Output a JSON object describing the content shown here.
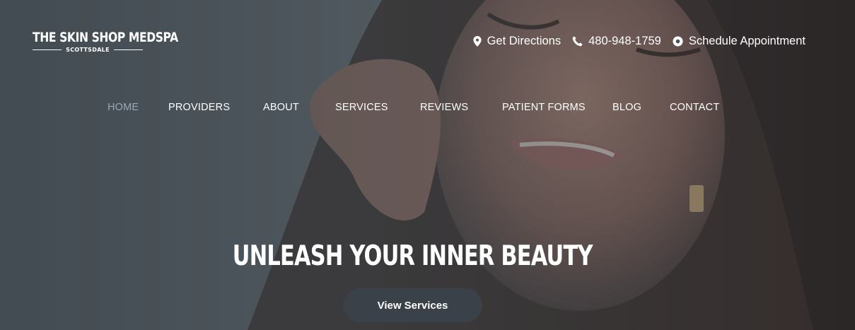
{
  "brand": {
    "name": "THE SKIN SHOP MEDSPA",
    "location": "SCOTTSDALE"
  },
  "topbar": {
    "directions_label": "Get Directions",
    "phone_label": "480-948-1759",
    "appointment_label": "Schedule Appointment"
  },
  "nav": {
    "items": [
      "HOME",
      "PROVIDERS",
      "ABOUT",
      "SERVICES",
      "REVIEWS",
      "PATIENT FORMS",
      "BLOG",
      "CONTACT"
    ],
    "active": "HOME"
  },
  "hero": {
    "headline": "UNLEASH YOUR INNER BEAUTY",
    "cta_label": "View Services"
  },
  "colors": {
    "overlay": "#3a4248",
    "nav_active": "#9aa9b4",
    "cta_bg": "#3b4148"
  }
}
